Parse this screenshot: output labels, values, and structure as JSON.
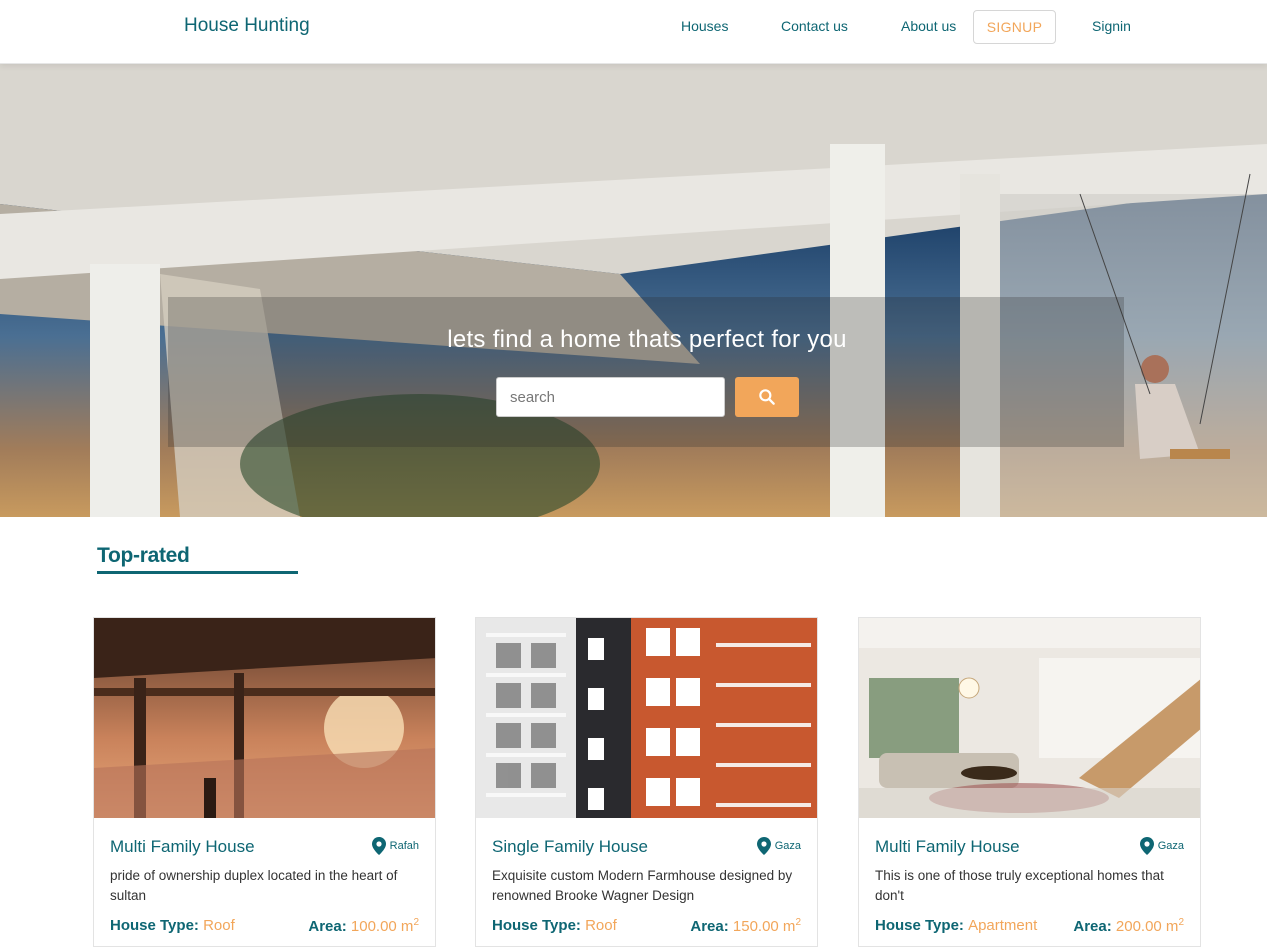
{
  "navbar": {
    "brand": "House Hunting",
    "links": {
      "houses": "Houses",
      "contact": "Contact us",
      "about": "About us",
      "signup": "SIGNUP",
      "signin": "Signin"
    }
  },
  "hero": {
    "title": "lets find a home thats perfect for you",
    "search_placeholder": "search",
    "search_icon": "search-icon"
  },
  "top_rated": {
    "heading": "Top-rated",
    "cards": [
      {
        "title": "Multi Family House",
        "location": "Rafah",
        "description": "pride of ownership duplex located in the heart of sultan",
        "house_type_label": "House Type:",
        "house_type": "Roof",
        "area_label": "Area:",
        "area": "100.00 m",
        "area_unit_sup": "2"
      },
      {
        "title": "Single Family House",
        "location": "Gaza",
        "description": "Exquisite custom Modern Farmhouse designed by renowned Brooke Wagner Design",
        "house_type_label": "House Type:",
        "house_type": "Roof",
        "area_label": "Area:",
        "area": "150.00 m",
        "area_unit_sup": "2"
      },
      {
        "title": "Multi Family House",
        "location": "Gaza",
        "description": "This is one of those truly exceptional homes that don't",
        "house_type_label": "House Type:",
        "house_type": "Apartment",
        "area_label": "Area:",
        "area": "200.00 m",
        "area_unit_sup": "2"
      }
    ]
  },
  "colors": {
    "primary": "#0e6673",
    "accent": "#f2a65a"
  }
}
